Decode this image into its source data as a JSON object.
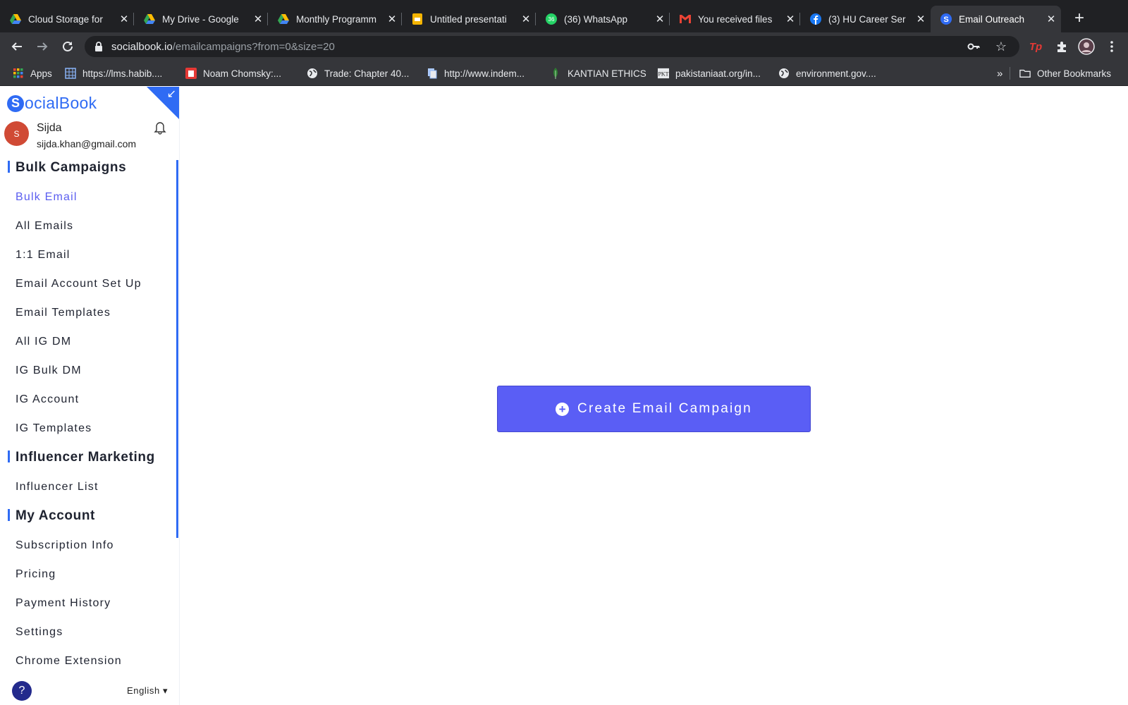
{
  "browser": {
    "tabs": [
      {
        "title": "Cloud Storage for",
        "favicon": "google-drive-icon"
      },
      {
        "title": "My Drive - Google",
        "favicon": "google-drive-icon"
      },
      {
        "title": "Monthly Programm",
        "favicon": "google-drive-icon"
      },
      {
        "title": "Untitled presentati",
        "favicon": "google-slides-icon"
      },
      {
        "title": "(36) WhatsApp",
        "favicon": "whatsapp-icon",
        "badge": "36"
      },
      {
        "title": "You received files",
        "favicon": "gmail-icon"
      },
      {
        "title": "(3) HU Career Ser",
        "favicon": "facebook-icon"
      },
      {
        "title": "Email Outreach",
        "favicon": "socialbook-icon",
        "active": true
      }
    ],
    "url_host": "socialbook.io",
    "url_path": "/emailcampaigns?from=0&size=20",
    "bookmarks": [
      {
        "label": "Apps",
        "icon": "apps-grid-icon"
      },
      {
        "label": "https://lms.habib....",
        "icon": "grid-page-icon"
      },
      {
        "label": "Noam Chomsky:...",
        "icon": "red-page-icon"
      },
      {
        "label": "Trade: Chapter 40...",
        "icon": "globe-icon"
      },
      {
        "label": "http://www.indem...",
        "icon": "page-icon"
      },
      {
        "label": "KANTIAN ETHICS",
        "icon": "leaf-icon"
      },
      {
        "label": "pakistaniaat.org/in...",
        "icon": "pkt-icon"
      },
      {
        "label": "environment.gov....",
        "icon": "globe-icon"
      }
    ],
    "overflow_label": "»",
    "other_bookmarks": "Other Bookmarks",
    "profile_initial": "Tp"
  },
  "app": {
    "brand_letter": "S",
    "brand_rest": "ocialBook",
    "user_name": "Sijda",
    "user_email": "sijda.khan@gmail.com",
    "avatar_initial": "S",
    "nav": [
      {
        "type": "section",
        "label": "Bulk Campaigns"
      },
      {
        "type": "item",
        "label": "Bulk Email",
        "active": true
      },
      {
        "type": "item",
        "label": "All Emails"
      },
      {
        "type": "item",
        "label": "1:1 Email"
      },
      {
        "type": "item",
        "label": "Email Account Set Up"
      },
      {
        "type": "item",
        "label": "Email Templates"
      },
      {
        "type": "item",
        "label": "All IG DM"
      },
      {
        "type": "item",
        "label": "IG Bulk DM"
      },
      {
        "type": "item",
        "label": "IG Account"
      },
      {
        "type": "item",
        "label": "IG Templates"
      },
      {
        "type": "section",
        "label": "Influencer Marketing"
      },
      {
        "type": "item",
        "label": "Influencer List"
      },
      {
        "type": "section",
        "label": "My Account"
      },
      {
        "type": "item",
        "label": "Subscription Info"
      },
      {
        "type": "item",
        "label": "Pricing"
      },
      {
        "type": "item",
        "label": "Payment History"
      },
      {
        "type": "item",
        "label": "Settings"
      },
      {
        "type": "item",
        "label": "Chrome Extension"
      }
    ],
    "help_label": "?",
    "language": "English ▾",
    "cta_label": "Create Email Campaign"
  },
  "colors": {
    "brand": "#2f6bf4",
    "cta": "#5a5ef5",
    "active_nav": "#5b5ef0",
    "avatar": "#d04a35",
    "chrome_dark": "#202124",
    "chrome_toolbar": "#35363a"
  }
}
